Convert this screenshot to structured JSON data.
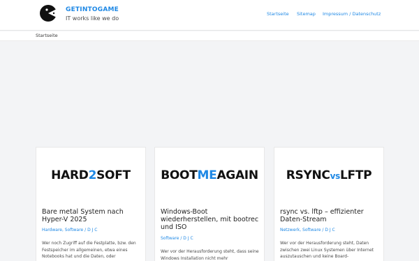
{
  "site": {
    "title": "GETINTOGAME",
    "tagline": "IT works like we do"
  },
  "nav": {
    "items": [
      {
        "label": "Startseite"
      },
      {
        "label": "Sitemap"
      },
      {
        "label": "Impressum / Datenschutz"
      }
    ]
  },
  "breadcrumb": {
    "current": "Startseite"
  },
  "posts": [
    {
      "image_text": {
        "pre": "HARD",
        "accent": "2",
        "post": "SOFT"
      },
      "title": "Bare metal System nach Hyper-V 2025",
      "meta": "Hardware, Software / D J C",
      "excerpt": "Wer noch Zugriff auf die Festplatte, bzw. den Festspeicher im allgemeinen, etwa eines Notebooks hat und die Daten, oder"
    },
    {
      "image_text": {
        "pre": "BOOT",
        "accent": "ME",
        "post": "AGAIN"
      },
      "title": "Windows-Boot wiederherstellen, mit bootrec und ISO",
      "meta": "Software / D J C",
      "excerpt": "Wer vor der Herausforderung steht, dass seine Windows Installation nicht mehr"
    },
    {
      "image_text": {
        "pre": "RSYNC",
        "accent": "vs",
        "post": "LFTP"
      },
      "title": "rsync vs. lftp – effizienter Daten-Stream",
      "meta": "Netzwerk, Software / D J C",
      "excerpt": "Wer vor der Herausforderung steht, Daten zwischen zwei Linux Systemen über Internet auszutauschen und keine Board-"
    }
  ],
  "colors": {
    "accent": "#1e88e5",
    "background": "#f3f4f6",
    "card": "#ffffff"
  },
  "icons": {
    "logo": "pacman-c-logo"
  }
}
